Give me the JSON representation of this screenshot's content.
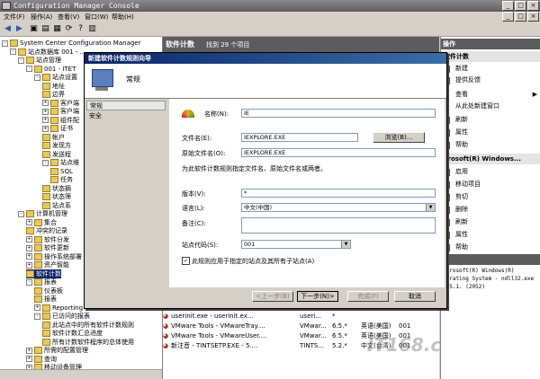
{
  "window": {
    "title": "Configuration Manager Console"
  },
  "menu": [
    "文件(F)",
    "操作(A)",
    "查看(V)",
    "窗口(W)",
    "帮助(H)"
  ],
  "tree": {
    "items": [
      {
        "label": "System Center Configuration Manager",
        "indent": 0,
        "pm": "-"
      },
      {
        "label": "站点数据库 001 - ...",
        "indent": 1,
        "pm": "-"
      },
      {
        "label": "站点管理",
        "indent": 2,
        "pm": "-"
      },
      {
        "label": "001 - ITET",
        "indent": 3,
        "pm": "-"
      },
      {
        "label": "站点设置",
        "indent": 4,
        "pm": "-"
      },
      {
        "label": "地址",
        "indent": 5,
        "pm": ""
      },
      {
        "label": "边界",
        "indent": 5,
        "pm": ""
      },
      {
        "label": "客户端",
        "indent": 5,
        "pm": "+"
      },
      {
        "label": "客户端",
        "indent": 5,
        "pm": "+"
      },
      {
        "label": "组件配",
        "indent": 5,
        "pm": "+"
      },
      {
        "label": "证书",
        "indent": 5,
        "pm": "+"
      },
      {
        "label": "帐户",
        "indent": 5,
        "pm": ""
      },
      {
        "label": "发现方",
        "indent": 5,
        "pm": ""
      },
      {
        "label": "发送程",
        "indent": 5,
        "pm": ""
      },
      {
        "label": "站点维",
        "indent": 5,
        "pm": "-"
      },
      {
        "label": "SQL",
        "indent": 6,
        "pm": ""
      },
      {
        "label": "任务",
        "indent": 6,
        "pm": ""
      },
      {
        "label": "状态摘",
        "indent": 5,
        "pm": ""
      },
      {
        "label": "状态筛",
        "indent": 5,
        "pm": ""
      },
      {
        "label": "站点系",
        "indent": 5,
        "pm": ""
      },
      {
        "label": "计算机管理",
        "indent": 2,
        "pm": "-"
      },
      {
        "label": "集合",
        "indent": 3,
        "pm": "+"
      },
      {
        "label": "冲突的记录",
        "indent": 3,
        "pm": ""
      },
      {
        "label": "软件分发",
        "indent": 3,
        "pm": "+"
      },
      {
        "label": "软件更新",
        "indent": 3,
        "pm": "+"
      },
      {
        "label": "操作系统部署",
        "indent": 3,
        "pm": "+"
      },
      {
        "label": "资产智能",
        "indent": 3,
        "pm": "+"
      },
      {
        "label": "软件计数",
        "indent": 3,
        "pm": "",
        "selected": true
      },
      {
        "label": "报表",
        "indent": 3,
        "pm": "-"
      },
      {
        "label": "仪表板",
        "indent": 4,
        "pm": ""
      },
      {
        "label": "报表",
        "indent": 4,
        "pm": ""
      },
      {
        "label": "Reporting",
        "indent": 4,
        "pm": "+"
      },
      {
        "label": "已访问的报表",
        "indent": 4,
        "pm": "-"
      },
      {
        "label": "此站点中的所有软件计数规则",
        "indent": 5,
        "pm": ""
      },
      {
        "label": "软件计数汇总进度",
        "indent": 5,
        "pm": ""
      },
      {
        "label": "所有计数软件程序的总体使用",
        "indent": 5,
        "pm": ""
      },
      {
        "label": "所需的配置管理",
        "indent": 3,
        "pm": "+"
      },
      {
        "label": "查询",
        "indent": 3,
        "pm": "+"
      },
      {
        "label": "移动设备管理",
        "indent": 3,
        "pm": "+"
      }
    ]
  },
  "center": {
    "title": "软件计数",
    "count_text": "找到 29 个项目",
    "rows": [
      {
        "name": "userinit.exe - userinit.ex...",
        "file": "useri...",
        "ver": "*",
        "lang": "",
        "site": ""
      },
      {
        "name": "VMware Tools - VMwareTray....",
        "file": "VMwar...",
        "ver": "6.5.*",
        "lang": "英语(美国)",
        "site": "001"
      },
      {
        "name": "VMware Tools - VMwareUser....",
        "file": "VMwar...",
        "ver": "6.5.*",
        "lang": "英语(美国)",
        "site": "001"
      },
      {
        "name": "新注音 - TINTSETP.EXE - 5....",
        "file": "TINTS...",
        "ver": "5.2.*",
        "lang": "中文(台湾)",
        "site": "001"
      }
    ]
  },
  "actions": {
    "header": "操作",
    "items": [
      "软件计数",
      "新建",
      "提供反馈",
      "查看",
      "从此处新建窗口",
      "刷新",
      "属性",
      "帮助"
    ],
    "header2": "icrosoft(R) Windows...",
    "items2": [
      "启用",
      "移动项目",
      "剪切",
      "删除",
      "刷新",
      "属性",
      "帮助"
    ],
    "header3": "述",
    "desc": "icrosoft(R) Windows(R) perating System - ndll32.exe - 5.1. (2052)"
  },
  "dialog": {
    "title": "新建软件计数规则向导",
    "head_label": "常规",
    "nav": [
      "常规",
      "安全"
    ],
    "name_label": "名称(N):",
    "name_value": "IE",
    "file_label": "文件名(E):",
    "file_value": "IEXPLORE.EXE",
    "browse_label": "浏览(B)...",
    "orig_label": "原始文件名(O):",
    "orig_value": "IEXPLORE.EXE",
    "hint": "为此软件计数规则指定文件名、原始文件名或两者。",
    "version_label": "版本(V):",
    "version_value": "*",
    "lang_label": "语言(L):",
    "lang_value": "中文(中国)",
    "note_label": "备注(C):",
    "note_value": "",
    "site_label": "站点代码(S):",
    "site_value": "001",
    "checkbox_label": "此规则应用于指定的站点及其所有子站点(A)",
    "btn_back": "<上一步(B)",
    "btn_next": "下一步(N)>",
    "btn_finish": "完成(F)",
    "btn_cancel": "取消"
  },
  "watermark": "IT168.com"
}
